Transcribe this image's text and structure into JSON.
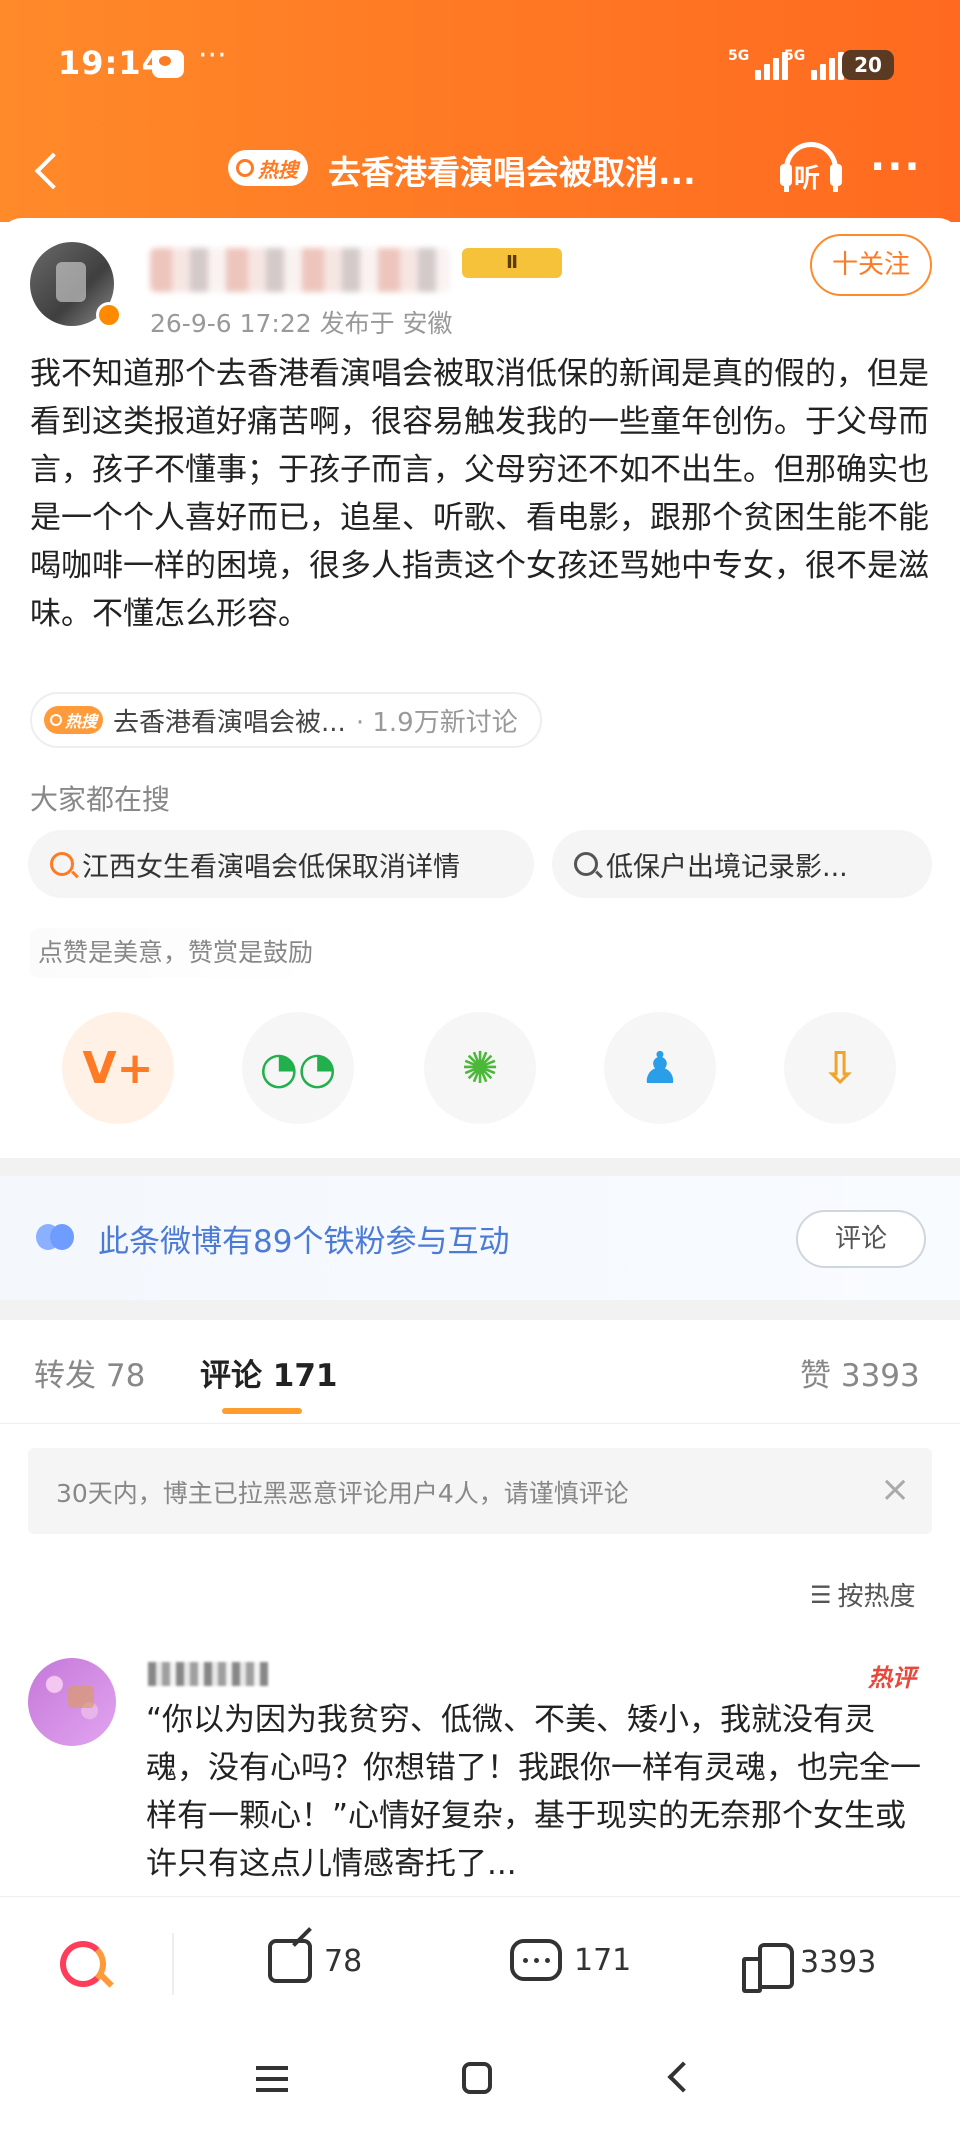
{
  "status_bar": {
    "time": "19:14",
    "signal_1": "5G",
    "signal_2": "5G",
    "battery": "20"
  },
  "navbar": {
    "hot_tag": "热搜",
    "title": "去香港看演唱会被取消...",
    "listen_label": "听",
    "more_label": "···"
  },
  "post": {
    "level_badge": "Ⅱ",
    "meta": "26-9-6 17:22  发布于 安徽",
    "follow_label": "十关注",
    "text": "我不知道那个去香港看演唱会被取消低保的新闻是真的假的，但是看到这类报道好痛苦啊，很容易触发我的一些童年创伤。于父母而言，孩子不懂事；于孩子而言，父母穷还不如不出生。但那确实也是一个个人喜好而已，追星、听歌、看电影，跟那个贫困生能不能喝咖啡一样的困境，很多人指责这个女孩还骂她中专女，很不是滋味。不懂怎么形容。",
    "topic": {
      "hot_tag": "热搜",
      "title": "去香港看演唱会被...",
      "discussion": "· 1.9万新讨论"
    },
    "search_label": "大家都在搜",
    "searches": [
      "江西女生看演唱会低保取消详情",
      "低保户出境记录影..."
    ],
    "praise_tip": "点赞是美意，赞赏是鼓励",
    "share_buttons": [
      {
        "icon": "reward-v-icon",
        "glyph": "V+",
        "color": "#ff7a24"
      },
      {
        "icon": "wechat-icon",
        "glyph": "◔◔",
        "color": "#21b04b"
      },
      {
        "icon": "moments-icon",
        "glyph": "✺",
        "color": "#4bb83a"
      },
      {
        "icon": "qq-icon",
        "glyph": "♟",
        "color": "#2a9ee8"
      },
      {
        "icon": "save-image-icon",
        "glyph": "⇩",
        "color": "#f0a52a"
      }
    ]
  },
  "fans_banner": {
    "text": "此条微博有89个铁粉参与互动",
    "button": "评论"
  },
  "tabs": {
    "repost": "转发 78",
    "comment": "评论 171",
    "likes": "赞 3393"
  },
  "notice": {
    "text": "30天内，博主已拉黑恶意评论用户4人，请谨慎评论",
    "close": "×"
  },
  "sort": {
    "icon": "☰",
    "label": "按热度"
  },
  "comment": {
    "hot_label": "热评",
    "text": "“你以为因为我贫穷、低微、不美、矮小，我就没有灵魂，没有心吗？你想错了！我跟你一样有灵魂，也完全一样有一颗心！”心情好复杂，基于现实的无奈那个女生或许只有这点儿情感寄托了..."
  },
  "action_bar": {
    "repost_count": "78",
    "comment_count": "171",
    "like_count": "3393"
  },
  "colors": {
    "brand": "#ff7a24",
    "link": "#4c7bd6",
    "hot": "#e8483b"
  }
}
